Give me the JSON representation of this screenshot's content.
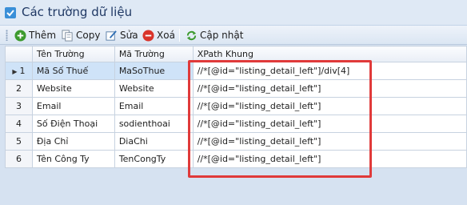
{
  "window": {
    "title": "Các trường dữ liệu"
  },
  "toolbar": {
    "add_label": "Thêm",
    "copy_label": "Copy",
    "edit_label": "Sửa",
    "delete_label": "Xoá",
    "update_label": "Cập nhật"
  },
  "grid": {
    "columns": [
      "",
      "Tên Trường",
      "Mã Trường",
      "XPath Khung"
    ],
    "rows": [
      {
        "num": "1",
        "name": "Mã Số Thuế",
        "code": "MaSoThue",
        "xpath": "//*[@id=\"listing_detail_left\"]/div[4]"
      },
      {
        "num": "2",
        "name": "Website",
        "code": "Website",
        "xpath": "//*[@id=\"listing_detail_left\"]"
      },
      {
        "num": "3",
        "name": "Email",
        "code": "Email",
        "xpath": "//*[@id=\"listing_detail_left\"]"
      },
      {
        "num": "4",
        "name": "Số Điện Thoại",
        "code": "sodienthoai",
        "xpath": "//*[@id=\"listing_detail_left\"]"
      },
      {
        "num": "5",
        "name": "Địa Chỉ",
        "code": "DiaChi",
        "xpath": "//*[@id=\"listing_detail_left\"]"
      },
      {
        "num": "6",
        "name": "Tên Công Ty",
        "code": "TenCongTy",
        "xpath": "//*[@id=\"listing_detail_left\"]"
      }
    ]
  },
  "colors": {
    "highlight": "#e03a3a",
    "selected_row": "#cfe3f8",
    "background": "#d6e2f1"
  }
}
